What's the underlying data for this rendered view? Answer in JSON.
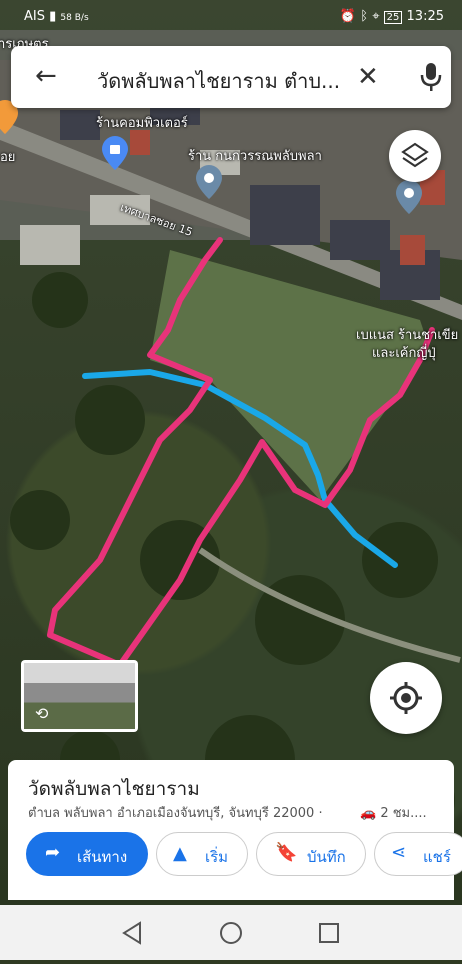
{
  "statusbar": {
    "carrier": "AIS",
    "net_speed": "58 B/s",
    "battery": "25",
    "time": "13:25"
  },
  "search": {
    "query": "วัดพลับพลาไชยาราม ตำบ..."
  },
  "map": {
    "labels": [
      "ารเกษตร",
      "ร้านคอมพิวเตอร์",
      "ร้าน กนกวรรณพลับพลา",
      "เทศบาลซอย 15",
      "เบแนส ร้านชาเขีย",
      "และเค้กญี่ปุ่",
      "อย"
    ]
  },
  "place": {
    "title": "วัดพลับพลาไชยาราม",
    "address": "ตำบล พลับพลา อำเภอเมืองจันทบุรี, จันทบุรี 22000 ·",
    "drive_time": "2 ชม...."
  },
  "actions": {
    "directions": "เส้นทาง",
    "start": "เริ่ม",
    "save": "บันทึก",
    "share": "แชร์"
  },
  "colors": {
    "accent": "#1a73e8",
    "pink_route": "#e8337a",
    "blue_route": "#1aa8e8"
  }
}
